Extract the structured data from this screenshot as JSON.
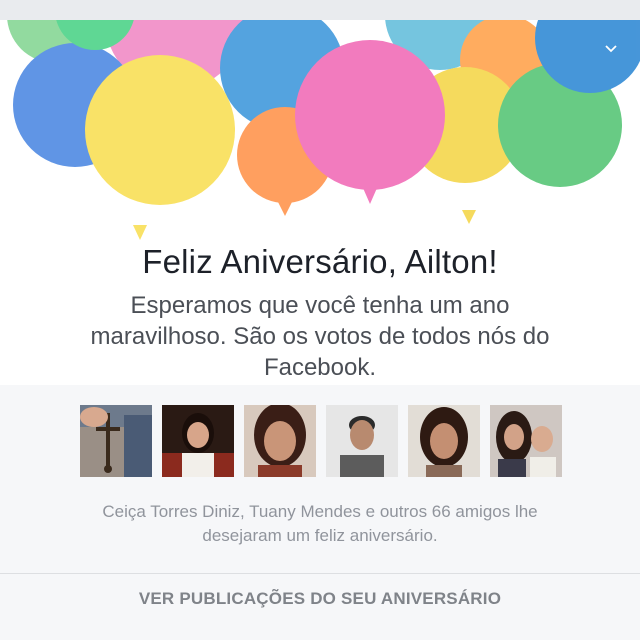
{
  "birthday": {
    "headline": "Feliz Aniversário, Ailton!",
    "message": "Esperamos que você tenha um ano maravilhoso. São os votos de todos nós do Facebook."
  },
  "friends_wished": {
    "summary": "Ceiça Torres Diniz, Tuany Mendes e outros 66 amigos lhe desejaram um feliz aniversário."
  },
  "actions": {
    "see_posts_label": "VER PUBLICAÇÕES DO SEU ANIVERSÁRIO"
  },
  "icons": {
    "collapse": "chevron-down-icon"
  },
  "colors": {
    "text_primary": "#1d2129",
    "text_secondary": "#4b4f56",
    "text_muted": "#90949c",
    "lower_bg": "#f6f7f9"
  }
}
